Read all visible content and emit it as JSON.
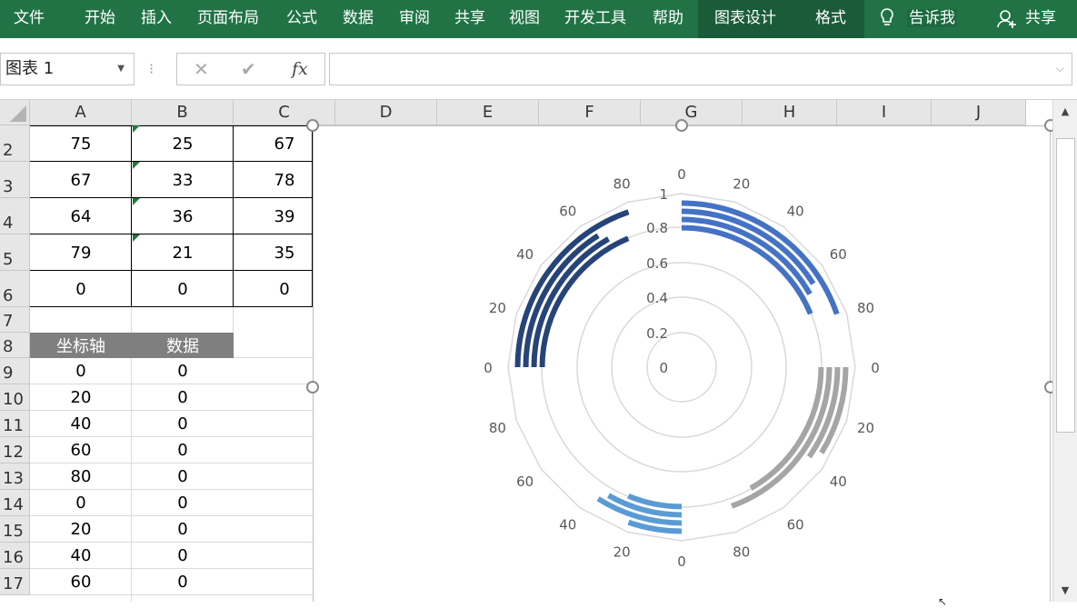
{
  "ribbon": {
    "tabs": [
      "文件",
      "开始",
      "插入",
      "页面布局",
      "公式",
      "数据",
      "审阅",
      "共享",
      "视图",
      "开发工具",
      "帮助",
      "图表设计",
      "格式"
    ],
    "tell_me": "告诉我",
    "share": "共享",
    "bg_color": "#217346",
    "active_bg": "#1a5c38"
  },
  "formula_bar": {
    "name_box": "图表 1",
    "cancel_icon": "✕",
    "confirm_icon": "✔",
    "fx_label": "fx",
    "content": ""
  },
  "grid": {
    "columns": [
      "A",
      "B",
      "C",
      "D",
      "E",
      "F",
      "G",
      "H",
      "I",
      "J"
    ],
    "rows": [
      "2",
      "3",
      "4",
      "5",
      "6",
      "7",
      "8",
      "9",
      "10",
      "11",
      "12",
      "13",
      "14",
      "15",
      "16",
      "17"
    ],
    "data_table": [
      [
        "75",
        "25",
        "67"
      ],
      [
        "67",
        "33",
        "78"
      ],
      [
        "64",
        "36",
        "39"
      ],
      [
        "79",
        "21",
        "35"
      ],
      [
        "0",
        "0",
        "0"
      ]
    ],
    "axis_headers": [
      "坐标轴",
      "数据"
    ],
    "axis_rows": [
      [
        "0",
        "0"
      ],
      [
        "20",
        "0"
      ],
      [
        "40",
        "0"
      ],
      [
        "60",
        "0"
      ],
      [
        "80",
        "0"
      ],
      [
        "0",
        "0"
      ],
      [
        "20",
        "0"
      ],
      [
        "40",
        "0"
      ],
      [
        "60",
        "0"
      ]
    ]
  },
  "chart_data": {
    "type": "radial-bar",
    "radial_axis_ticks": [
      "0",
      "0.2",
      "0.4",
      "0.6",
      "0.8",
      "1"
    ],
    "angular_labels": [
      "0",
      "20",
      "40",
      "60",
      "80",
      "0",
      "20",
      "40",
      "60",
      "80",
      "0",
      "20",
      "40",
      "60",
      "80",
      "0",
      "20",
      "40",
      "60",
      "80"
    ],
    "ring_fractions": [
      1,
      0.95,
      0.9,
      0.85
    ],
    "series": [
      {
        "color": "#4472c4",
        "values": [
          79,
          64,
          67,
          75
        ]
      },
      {
        "color": "#a5a5a5",
        "values": [
          35,
          39,
          78,
          67
        ]
      },
      {
        "color": "#5b9bd5",
        "values": [
          21,
          36,
          33,
          25
        ]
      },
      {
        "color": "#264478",
        "values": [
          79,
          64,
          67,
          75
        ]
      }
    ]
  }
}
